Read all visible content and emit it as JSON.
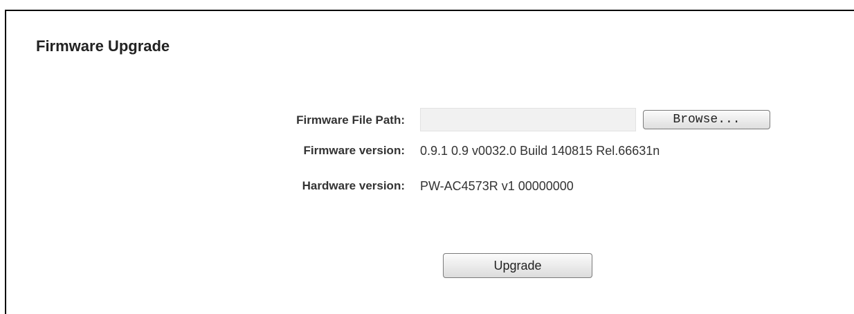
{
  "page": {
    "title": "Firmware Upgrade"
  },
  "form": {
    "firmware_file_path": {
      "label": "Firmware File Path:",
      "value": "",
      "placeholder": "",
      "browse_label": "Browse..."
    },
    "firmware_version": {
      "label": "Firmware version:",
      "value": "0.9.1 0.9 v0032.0 Build 140815 Rel.66631n"
    },
    "hardware_version": {
      "label": "Hardware version:",
      "value": "PW-AC4573R v1 00000000"
    },
    "upgrade_label": "Upgrade"
  },
  "colors": {
    "border": "#000000",
    "text": "#333333",
    "input_background": "#f1f1f1",
    "button_border": "#7a7a7a"
  }
}
